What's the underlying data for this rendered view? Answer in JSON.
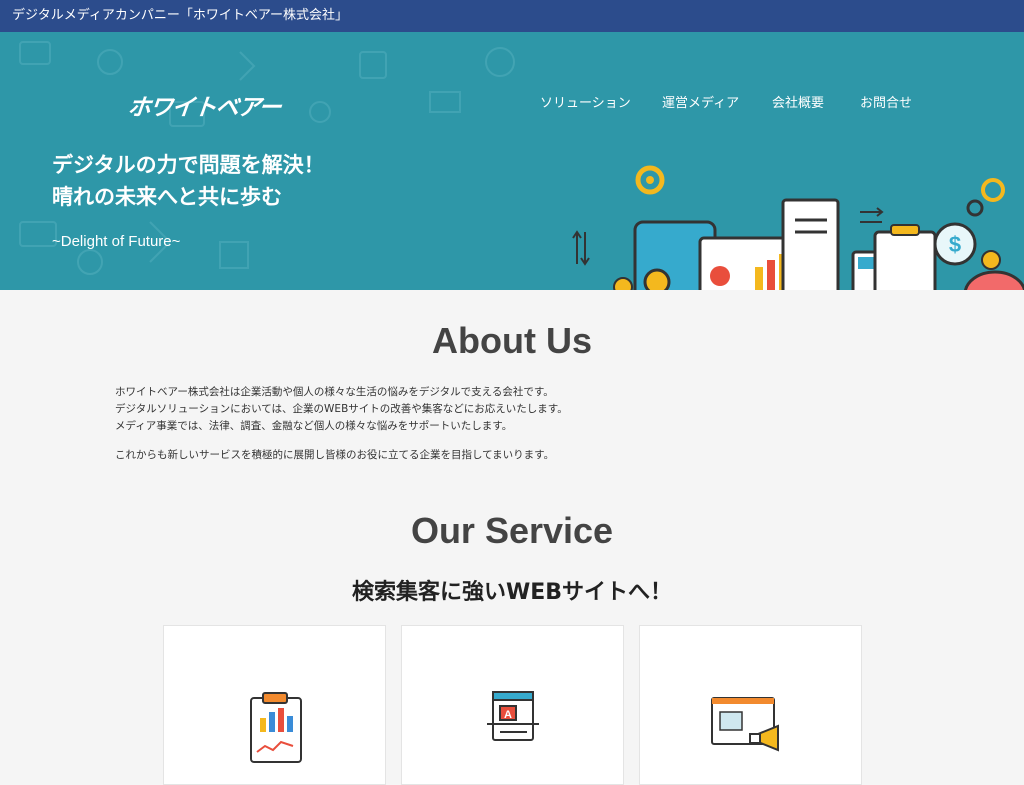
{
  "topbar": {
    "text": "デジタルメディアカンパニー「ホワイトベアー株式会社」"
  },
  "header": {
    "logo_text": "ホワイトベアー",
    "nav": [
      {
        "label": "ソリューション"
      },
      {
        "label": "運営メディア"
      },
      {
        "label": "会社概要"
      },
      {
        "label": "お問合せ"
      }
    ]
  },
  "hero": {
    "title_line1": "デジタルの力で問題を解決！",
    "title_line2": "晴れの未来へと共に歩む",
    "subtitle": "~Delight of Future~"
  },
  "about": {
    "title": "About Us",
    "lines": [
      "ホワイトベアー株式会社は企業活動や個人の様々な生活の悩みをデジタルで支える会社です。",
      "デジタルソリューションにおいては、企業のWEBサイトの改善や集客などにお応えいたします。",
      "メディア事業では、法律、調査、金融など個人の様々な悩みをサポートいたします。",
      "これからも新しいサービスを積極的に展開し皆様のお役に立てる企業を目指してまいります。"
    ]
  },
  "service": {
    "title": "Our Service",
    "subtitle": "検索集客に強いWEBサイトへ！",
    "cards": [
      {
        "icon": "clipboard-chart-icon"
      },
      {
        "icon": "web-design-icon"
      },
      {
        "icon": "megaphone-ad-icon"
      }
    ]
  },
  "colors": {
    "topbar": "#2c4c8c",
    "hero": "#2e97a8",
    "background": "#f5f5f5"
  }
}
